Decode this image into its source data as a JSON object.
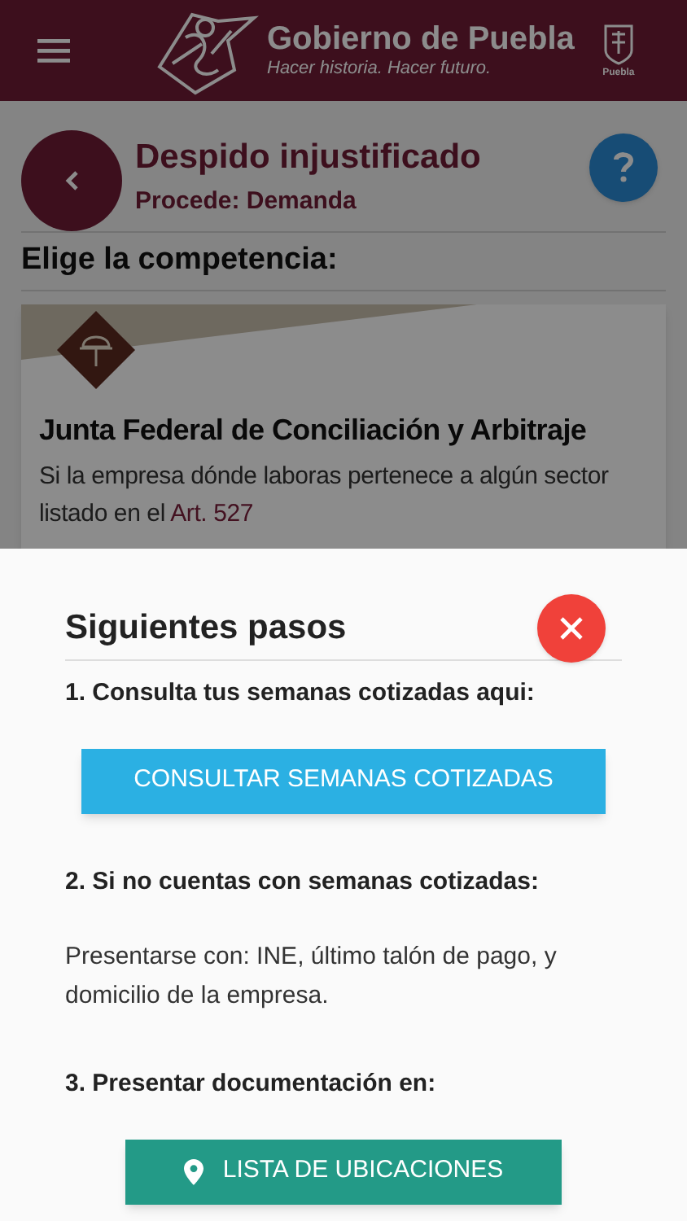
{
  "header": {
    "title": "Gobierno de Puebla",
    "tagline": "Hacer historia. Hacer futuro.",
    "crest_caption": "Puebla"
  },
  "page": {
    "title": "Despido injustificado",
    "subtitle": "Procede: Demanda",
    "section_heading": "Elige la competencia:"
  },
  "card": {
    "title": "Junta Federal de Conciliación y Arbitraje",
    "text": "Si la empresa dónde laboras pertenece a algún sector listado en el ",
    "link": "Art. 527"
  },
  "sheet": {
    "title": "Siguientes pasos",
    "steps": [
      {
        "heading": "1. Consulta tus semanas cotizadas aqui:",
        "kind": "button",
        "button": "CONSULTAR SEMANAS COTIZADAS",
        "color": "#2bb0e3"
      },
      {
        "heading": "2. Si no cuentas con semanas cotizadas:",
        "kind": "text",
        "text": "Presentarse con: INE, último talón de pago, y domicilio de la empresa."
      },
      {
        "heading": "3. Presentar documentación en:",
        "kind": "location-button",
        "button": "LISTA DE UBICACIONES",
        "color": "#239a87"
      }
    ]
  }
}
